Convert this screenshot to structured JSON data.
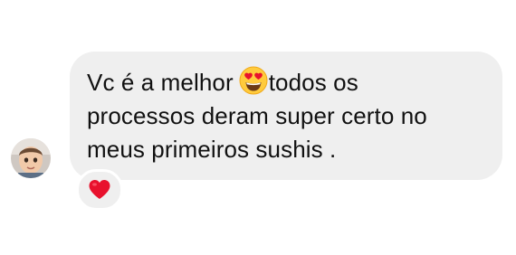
{
  "message": {
    "sender_avatar": "child-avatar",
    "line1_before": "Vc é a melhor",
    "inline_emoji": "heart-eyes-emoji",
    "line1_after": "todos os",
    "line2": "processos deram super certo no",
    "line3": "meus primeiros sushis ."
  },
  "reaction": {
    "icon": "red-heart-icon",
    "color": "#e8112d"
  },
  "colors": {
    "bubble": "#efefef",
    "text": "#111111",
    "background": "#ffffff"
  }
}
